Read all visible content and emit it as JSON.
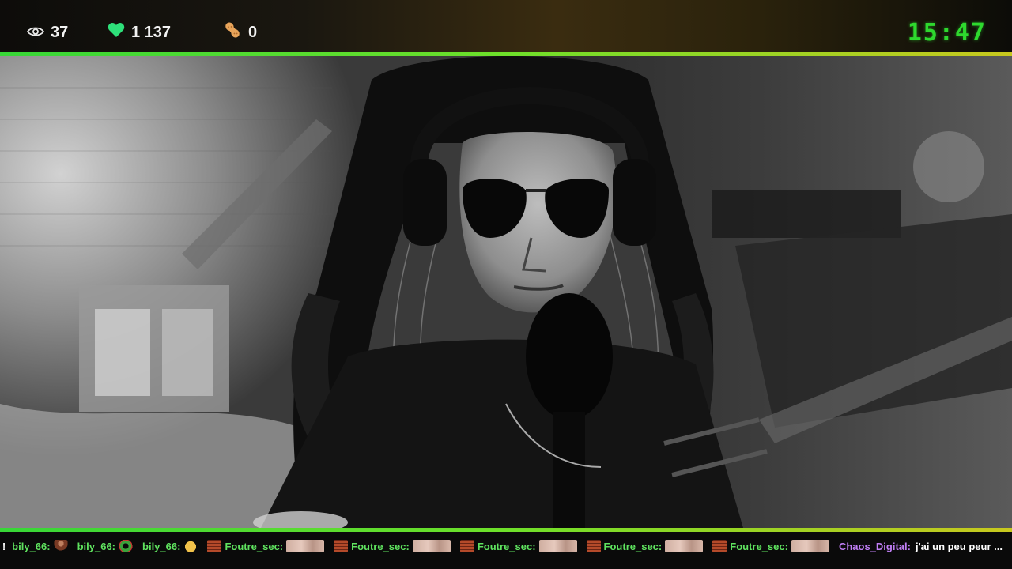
{
  "stats": {
    "viewers": "37",
    "likes": "1 137",
    "bits": "0"
  },
  "clock": "15:47",
  "colors": {
    "accent_green": "#37d737",
    "accent_yellow": "#c8c81e",
    "clock": "#2ed92e",
    "user_green": "#5fe35f",
    "user_purple": "#c07ef5"
  },
  "ticker": {
    "lead_fragment": "k !",
    "messages": [
      {
        "user": "bily_66:",
        "emote": "person-emote"
      },
      {
        "user": "bily_66:",
        "emote": "wreath-emote"
      },
      {
        "user": "bily_66:",
        "emote": "cat-emote"
      },
      {
        "emote_before": "brick-emote",
        "user": "Foutre_sec:",
        "emote": "face-emote"
      },
      {
        "emote_before": "brick-emote",
        "user": "Foutre_sec:",
        "emote": "face-emote"
      },
      {
        "emote_before": "brick-emote",
        "user": "Foutre_sec:",
        "emote": "face-emote"
      },
      {
        "emote_before": "brick-emote",
        "user": "Foutre_sec:",
        "emote": "face-emote"
      },
      {
        "emote_before": "brick-emote",
        "user": "Foutre_sec:",
        "emote": "face-emote"
      }
    ],
    "last": {
      "user": "Chaos_Digital:",
      "text": "j'ai un peu peur ..."
    }
  },
  "icons": {
    "viewers": "eye-icon",
    "likes": "heart-icon",
    "bits": "peanut-icon"
  }
}
